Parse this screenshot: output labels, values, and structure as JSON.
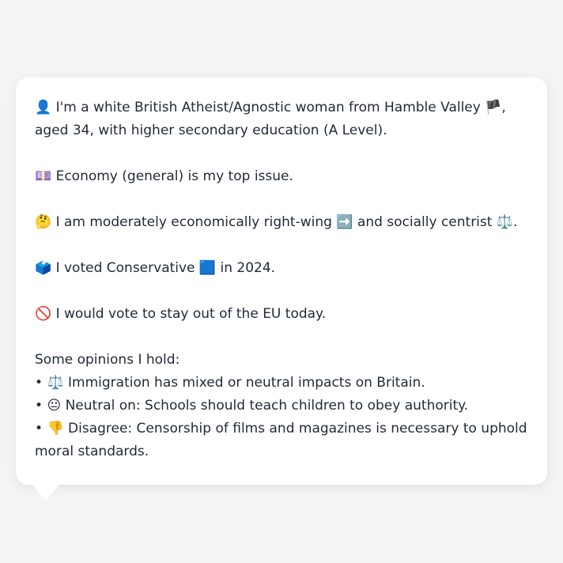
{
  "profile": {
    "identity": {
      "icon": "👤",
      "text_before_flag": "I'm a white British Atheist/Agnostic woman from Hamble Valley",
      "flag": "🏴",
      "text_after_flag": ", aged 34, with higher secondary education (A Level)."
    },
    "top_issue": {
      "icon": "💷",
      "text": "Economy (general) is my top issue."
    },
    "ideology": {
      "icon": "🤔",
      "text_a": "I am moderately economically right-wing",
      "econ_icon": "➡️",
      "text_b": "and socially centrist",
      "social_icon": "⚖️",
      "text_c": "."
    },
    "vote": {
      "icon": "🗳️",
      "text_a": "I voted Conservative",
      "party_icon": "🟦",
      "text_b": "in 2024."
    },
    "eu": {
      "icon": "🚫",
      "text": "I would vote to stay out of the EU today."
    },
    "opinions_heading": "Some opinions I hold:",
    "opinions": [
      {
        "bullet": "•",
        "icon": "⚖️",
        "text": "Immigration has mixed or neutral impacts on Britain."
      },
      {
        "bullet": "•",
        "icon": "😐",
        "text": "Neutral on: Schools should teach children to obey authority."
      },
      {
        "bullet": "•",
        "icon": "👎",
        "text": "Disagree: Censorship of films and magazines is necessary to uphold moral standards."
      }
    ]
  }
}
